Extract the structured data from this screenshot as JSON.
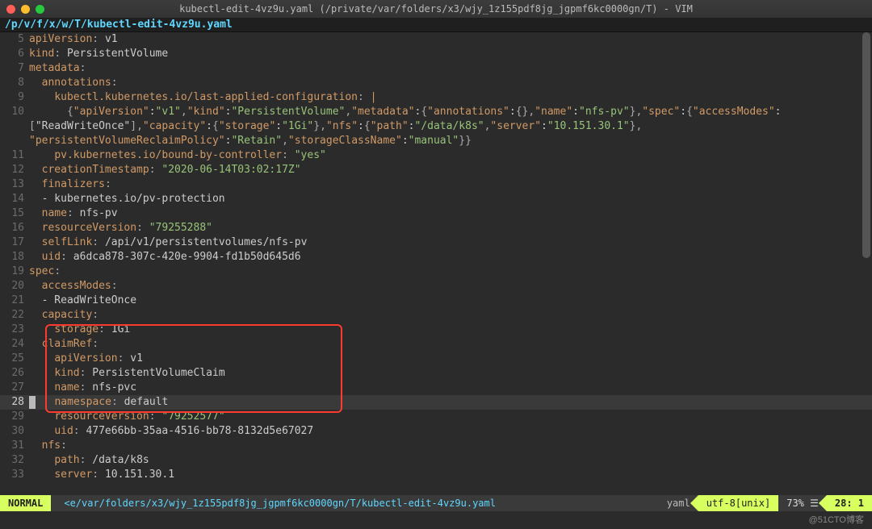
{
  "window": {
    "title": "kubectl-edit-4vz9u.yaml (/private/var/folders/x3/wjy_1z155pdf8jg_jgpmf6kc0000gn/T) - VIM"
  },
  "pathbar": "/p/v/f/x/w/T/kubectl-edit-4vz9u.yaml",
  "status": {
    "mode": "NORMAL",
    "file": "<e/var/folders/x3/wjy_1z155pdf8jg_jgpmf6kc0000gn/T/kubectl-edit-4vz9u.yaml",
    "filetype": "yaml",
    "encoding": "utf-8[unix]",
    "percent": "73% ☰",
    "position": "28:  1"
  },
  "watermark": "@51CTO博客",
  "lines": {
    "start": 5,
    "current": 28,
    "l5": {
      "k": "apiVersion",
      "v": "v1"
    },
    "l6": {
      "k": "kind",
      "v": "PersistentVolume"
    },
    "l7": {
      "k": "metadata"
    },
    "l8": {
      "k": "annotations"
    },
    "l9": {
      "k": "kubectl.kubernetes.io/last-applied-configuration",
      "v": "|"
    },
    "l10a": "{\"apiVersion\":\"v1\",\"kind\":\"PersistentVolume\",\"metadata\":{\"annotations\":{},\"name\":\"nfs-pv\"},\"spec\":{\"accessModes\":",
    "l10b": "[\"ReadWriteOnce\"],\"capacity\":{\"storage\":\"1Gi\"},\"nfs\":{\"path\":\"/data/k8s\",\"server\":\"10.151.30.1\"},",
    "l10c": "\"persistentVolumeReclaimPolicy\":\"Retain\",\"storageClassName\":\"manual\"}}",
    "l11": {
      "k": "pv.kubernetes.io/bound-by-controller",
      "v": "\"yes\""
    },
    "l12": {
      "k": "creationTimestamp",
      "v": "\"2020-06-14T03:02:17Z\""
    },
    "l13": {
      "k": "finalizers"
    },
    "l14": {
      "v": "- kubernetes.io/pv-protection"
    },
    "l15": {
      "k": "name",
      "v": "nfs-pv"
    },
    "l16": {
      "k": "resourceVersion",
      "v": "\"79255288\""
    },
    "l17": {
      "k": "selfLink",
      "v": "/api/v1/persistentvolumes/nfs-pv"
    },
    "l18": {
      "k": "uid",
      "v": "a6dca878-307c-420e-9904-fd1b50d645d6"
    },
    "l19": {
      "k": "spec"
    },
    "l20": {
      "k": "accessModes"
    },
    "l21": {
      "v": "- ReadWriteOnce"
    },
    "l22": {
      "k": "capacity"
    },
    "l23": {
      "k": "storage",
      "v": "1Gi"
    },
    "l24": {
      "k": "claimRef"
    },
    "l25": {
      "k": "apiVersion",
      "v": "v1"
    },
    "l26": {
      "k": "kind",
      "v": "PersistentVolumeClaim"
    },
    "l27": {
      "k": "name",
      "v": "nfs-pvc"
    },
    "l28": {
      "k": "namespace",
      "v": "default"
    },
    "l29": {
      "k": "resourceVersion",
      "v": "\"79252577\""
    },
    "l30": {
      "k": "uid",
      "v": "477e66bb-35aa-4516-bb78-8132d5e67027"
    },
    "l31": {
      "k": "nfs"
    },
    "l32": {
      "k": "path",
      "v": "/data/k8s"
    },
    "l33": {
      "k": "server",
      "v": "10.151.30.1"
    }
  }
}
